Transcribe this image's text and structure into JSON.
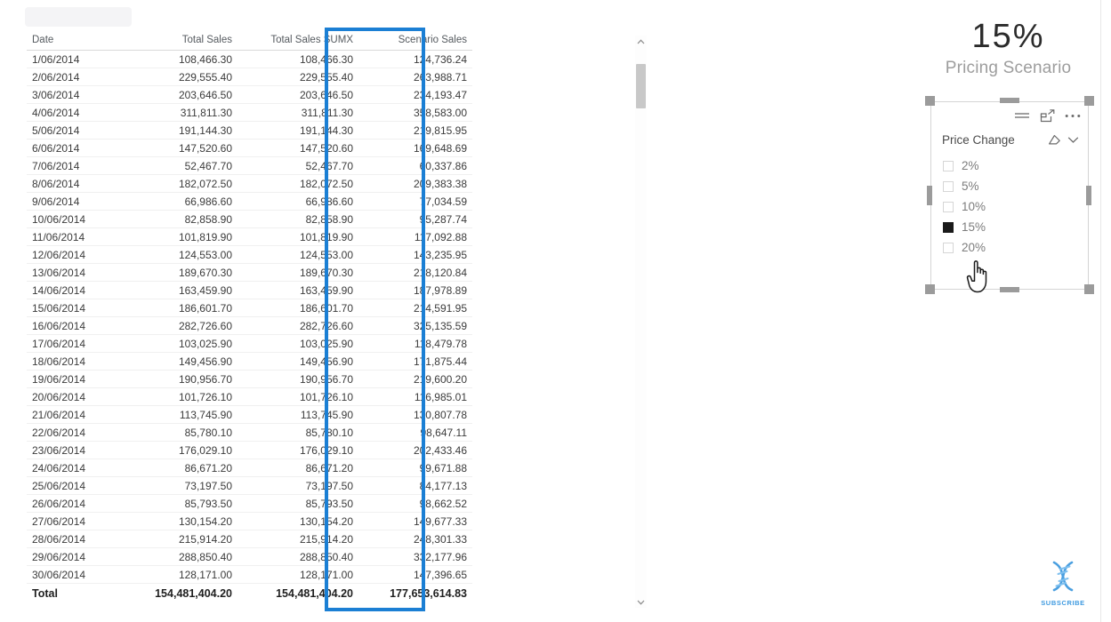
{
  "colors": {
    "highlight_blue": "#1b7fd4",
    "selected_checkbox": "#1a1a1a",
    "kpi_text": "#2b2b2b",
    "kpi_label": "#9d9d9d",
    "subscribe_blue": "#3f9ae0"
  },
  "table": {
    "columns": [
      "Date",
      "Total Sales",
      "Total Sales SUMX",
      "Scenario Sales"
    ],
    "highlighted_column": "Scenario Sales",
    "rows": [
      [
        "1/06/2014",
        "108,466.30",
        "108,466.30",
        "124,736.24"
      ],
      [
        "2/06/2014",
        "229,555.40",
        "229,555.40",
        "263,988.71"
      ],
      [
        "3/06/2014",
        "203,646.50",
        "203,646.50",
        "234,193.47"
      ],
      [
        "4/06/2014",
        "311,811.30",
        "311,811.30",
        "358,583.00"
      ],
      [
        "5/06/2014",
        "191,144.30",
        "191,144.30",
        "219,815.95"
      ],
      [
        "6/06/2014",
        "147,520.60",
        "147,520.60",
        "169,648.69"
      ],
      [
        "7/06/2014",
        "52,467.70",
        "52,467.70",
        "60,337.86"
      ],
      [
        "8/06/2014",
        "182,072.50",
        "182,072.50",
        "209,383.38"
      ],
      [
        "9/06/2014",
        "66,986.60",
        "66,986.60",
        "77,034.59"
      ],
      [
        "10/06/2014",
        "82,858.90",
        "82,858.90",
        "95,287.74"
      ],
      [
        "11/06/2014",
        "101,819.90",
        "101,819.90",
        "117,092.88"
      ],
      [
        "12/06/2014",
        "124,553.00",
        "124,553.00",
        "143,235.95"
      ],
      [
        "13/06/2014",
        "189,670.30",
        "189,670.30",
        "218,120.84"
      ],
      [
        "14/06/2014",
        "163,459.90",
        "163,459.90",
        "187,978.89"
      ],
      [
        "15/06/2014",
        "186,601.70",
        "186,601.70",
        "214,591.95"
      ],
      [
        "16/06/2014",
        "282,726.60",
        "282,726.60",
        "325,135.59"
      ],
      [
        "17/06/2014",
        "103,025.90",
        "103,025.90",
        "118,479.78"
      ],
      [
        "18/06/2014",
        "149,456.90",
        "149,456.90",
        "171,875.44"
      ],
      [
        "19/06/2014",
        "190,956.70",
        "190,956.70",
        "219,600.20"
      ],
      [
        "20/06/2014",
        "101,726.10",
        "101,726.10",
        "116,985.01"
      ],
      [
        "21/06/2014",
        "113,745.90",
        "113,745.90",
        "130,807.78"
      ],
      [
        "22/06/2014",
        "85,780.10",
        "85,780.10",
        "98,647.11"
      ],
      [
        "23/06/2014",
        "176,029.10",
        "176,029.10",
        "202,433.46"
      ],
      [
        "24/06/2014",
        "86,671.20",
        "86,671.20",
        "99,671.88"
      ],
      [
        "25/06/2014",
        "73,197.50",
        "73,197.50",
        "84,177.13"
      ],
      [
        "26/06/2014",
        "85,793.50",
        "85,793.50",
        "98,662.52"
      ],
      [
        "27/06/2014",
        "130,154.20",
        "130,154.20",
        "149,677.33"
      ],
      [
        "28/06/2014",
        "215,914.20",
        "215,914.20",
        "248,301.33"
      ],
      [
        "29/06/2014",
        "288,850.40",
        "288,850.40",
        "332,177.96"
      ],
      [
        "30/06/2014",
        "128,171.00",
        "128,171.00",
        "147,396.65"
      ]
    ],
    "total_row": [
      "Total",
      "154,481,404.20",
      "154,481,404.20",
      "177,653,614.83"
    ]
  },
  "scrollbar": {
    "up_arrow": "chevron-up",
    "down_arrow": "chevron-down"
  },
  "kpi": {
    "value": "15%",
    "label": "Pricing Scenario"
  },
  "slicer": {
    "title": "Price Change",
    "header_icons": [
      "filter-icon",
      "focus-mode-icon",
      "more-options-icon"
    ],
    "title_icons": [
      "clear-selections-icon",
      "chevron-down-icon"
    ],
    "items": [
      {
        "label": "2%",
        "checked": false
      },
      {
        "label": "5%",
        "checked": false
      },
      {
        "label": "10%",
        "checked": false
      },
      {
        "label": "15%",
        "checked": true
      },
      {
        "label": "20%",
        "checked": false
      }
    ],
    "selected": "15%"
  },
  "subscribe": {
    "label": "SUBSCRIBE",
    "icon": "dna-helix-icon"
  }
}
